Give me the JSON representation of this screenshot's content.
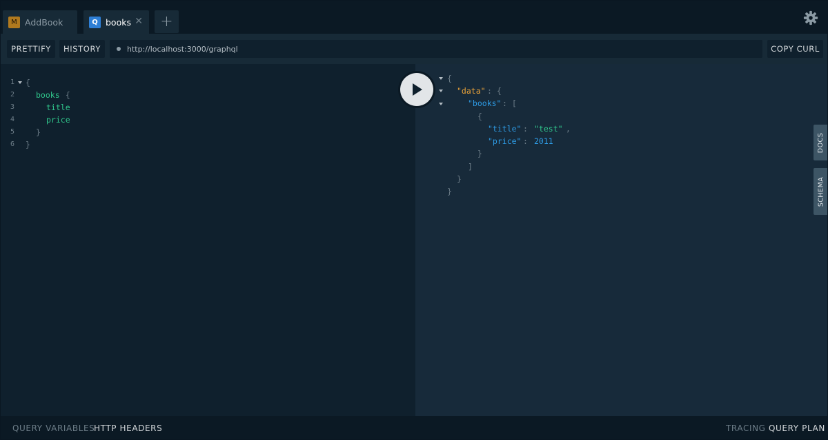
{
  "tabs": [
    {
      "badge": "M",
      "label": "AddBook"
    },
    {
      "badge": "Q",
      "label": "books",
      "close": "✕"
    }
  ],
  "tab_add": "+",
  "toolbar": {
    "prettify": "PRETTIFY",
    "history": "HISTORY",
    "url": "http://localhost:3000/graphql",
    "copy_curl": "COPY CURL"
  },
  "query_lines": [
    {
      "num": "1",
      "text": "{"
    },
    {
      "num": "2",
      "field": "books",
      "punc": " {"
    },
    {
      "num": "3",
      "field": "title"
    },
    {
      "num": "4",
      "field": "price"
    },
    {
      "num": "5",
      "text": "}"
    },
    {
      "num": "6",
      "text": "}"
    }
  ],
  "result": {
    "open_brace": "{",
    "data_key": "\"data\"",
    "books_key": "\"books\"",
    "title_key": "\"title\"",
    "title_val": "\"test\"",
    "price_key": "\"price\"",
    "price_val": "2011"
  },
  "side_tabs": {
    "docs": "DOCS",
    "schema": "SCHEMA"
  },
  "bottom": {
    "query_variables": "QUERY VARIABLES",
    "http_headers": "HTTP HEADERS",
    "tracing": "TRACING",
    "query_plan": "QUERY PLAN"
  },
  "colors": {
    "background": "#0f202d",
    "field": "#30c78c",
    "key": "#2e9be4",
    "data_key": "#eba339"
  }
}
